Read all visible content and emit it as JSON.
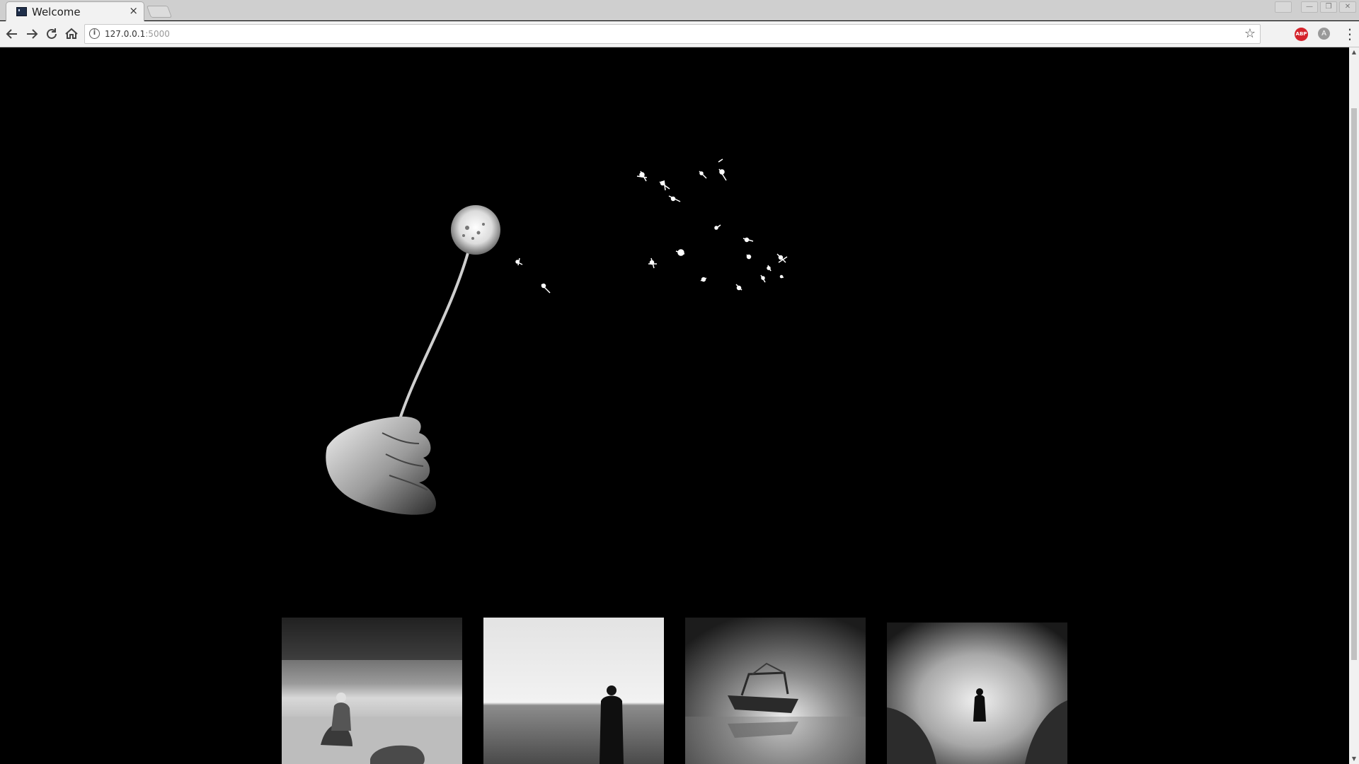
{
  "browser": {
    "tab_title": "Welcome",
    "tab_close": "×",
    "url_host": "127.0.0.1",
    "url_port": ":5000",
    "abp_label": "ABP",
    "extension_label": "A"
  },
  "page": {
    "hero_alt": "Hand holding a dandelion with seeds blowing away",
    "gallery": [
      {
        "alt": "Person sitting on a rock by the sea"
      },
      {
        "alt": "Person standing at the sea horizon"
      },
      {
        "alt": "Stranded boat on reflective water"
      },
      {
        "alt": "Figure in a coat standing on a shore"
      }
    ]
  },
  "icons": {
    "back": "arrow-left-icon",
    "forward": "arrow-right-icon",
    "reload": "reload-icon",
    "home": "home-icon",
    "info": "info-icon",
    "bookmark": "star-icon",
    "menu": "kebab-menu-icon"
  }
}
